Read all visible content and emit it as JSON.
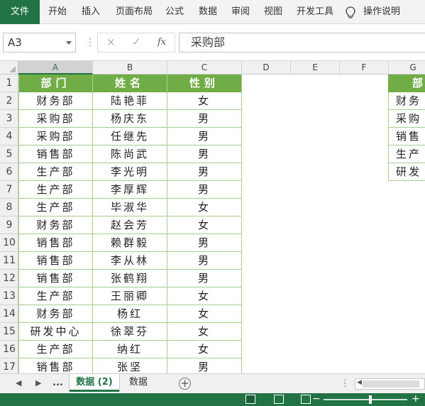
{
  "ribbon": {
    "file": "文件",
    "tabs": [
      "开始",
      "插入",
      "页面布局",
      "公式",
      "数据",
      "审阅",
      "视图",
      "开发工具"
    ],
    "tell_me": "操作说明"
  },
  "formula_bar": {
    "name_box": "A3",
    "cancel_icon": "×",
    "enter_icon": "✓",
    "fx": "fx",
    "content": "采购部"
  },
  "columns": [
    "A",
    "B",
    "C",
    "D",
    "E",
    "F",
    "G"
  ],
  "selected_column": "A",
  "rows": [
    "1",
    "2",
    "3",
    "4",
    "5",
    "6",
    "7",
    "8",
    "9",
    "10",
    "11",
    "12",
    "13",
    "14",
    "15",
    "16",
    "17"
  ],
  "table": {
    "headers": [
      "部门",
      "姓名",
      "性别"
    ],
    "data": [
      [
        "财务部",
        "陆艳菲",
        "女"
      ],
      [
        "采购部",
        "杨庆东",
        "男"
      ],
      [
        "采购部",
        "任继先",
        "男"
      ],
      [
        "销售部",
        "陈尚武",
        "男"
      ],
      [
        "生产部",
        "李光明",
        "男"
      ],
      [
        "生产部",
        "李厚辉",
        "男"
      ],
      [
        "生产部",
        "毕淑华",
        "女"
      ],
      [
        "财务部",
        "赵会芳",
        "女"
      ],
      [
        "销售部",
        "赖群毅",
        "男"
      ],
      [
        "销售部",
        "李从林",
        "男"
      ],
      [
        "销售部",
        "张鹤翔",
        "男"
      ],
      [
        "生产部",
        "王丽卿",
        "女"
      ],
      [
        "财务部",
        "杨红",
        "女"
      ],
      [
        "研发中心",
        "徐翠芬",
        "女"
      ],
      [
        "生产部",
        "纳红",
        "女"
      ],
      [
        "销售部",
        "张坚",
        "男"
      ]
    ]
  },
  "side_list": {
    "header": "部",
    "items": [
      "财务",
      "采购",
      "销售",
      "生产",
      "研发"
    ]
  },
  "sheets": {
    "nav_prev": "◀",
    "nav_next": "▶",
    "more": "...",
    "tabs": [
      "数据 (2)",
      "数据"
    ],
    "active": "数据 (2)",
    "add": "+"
  },
  "status": {
    "zoom_minus": "−",
    "zoom_plus": "+"
  },
  "colors": {
    "excel_green": "#217346",
    "header_fill": "#70ad47",
    "border": "#a9d08e"
  }
}
